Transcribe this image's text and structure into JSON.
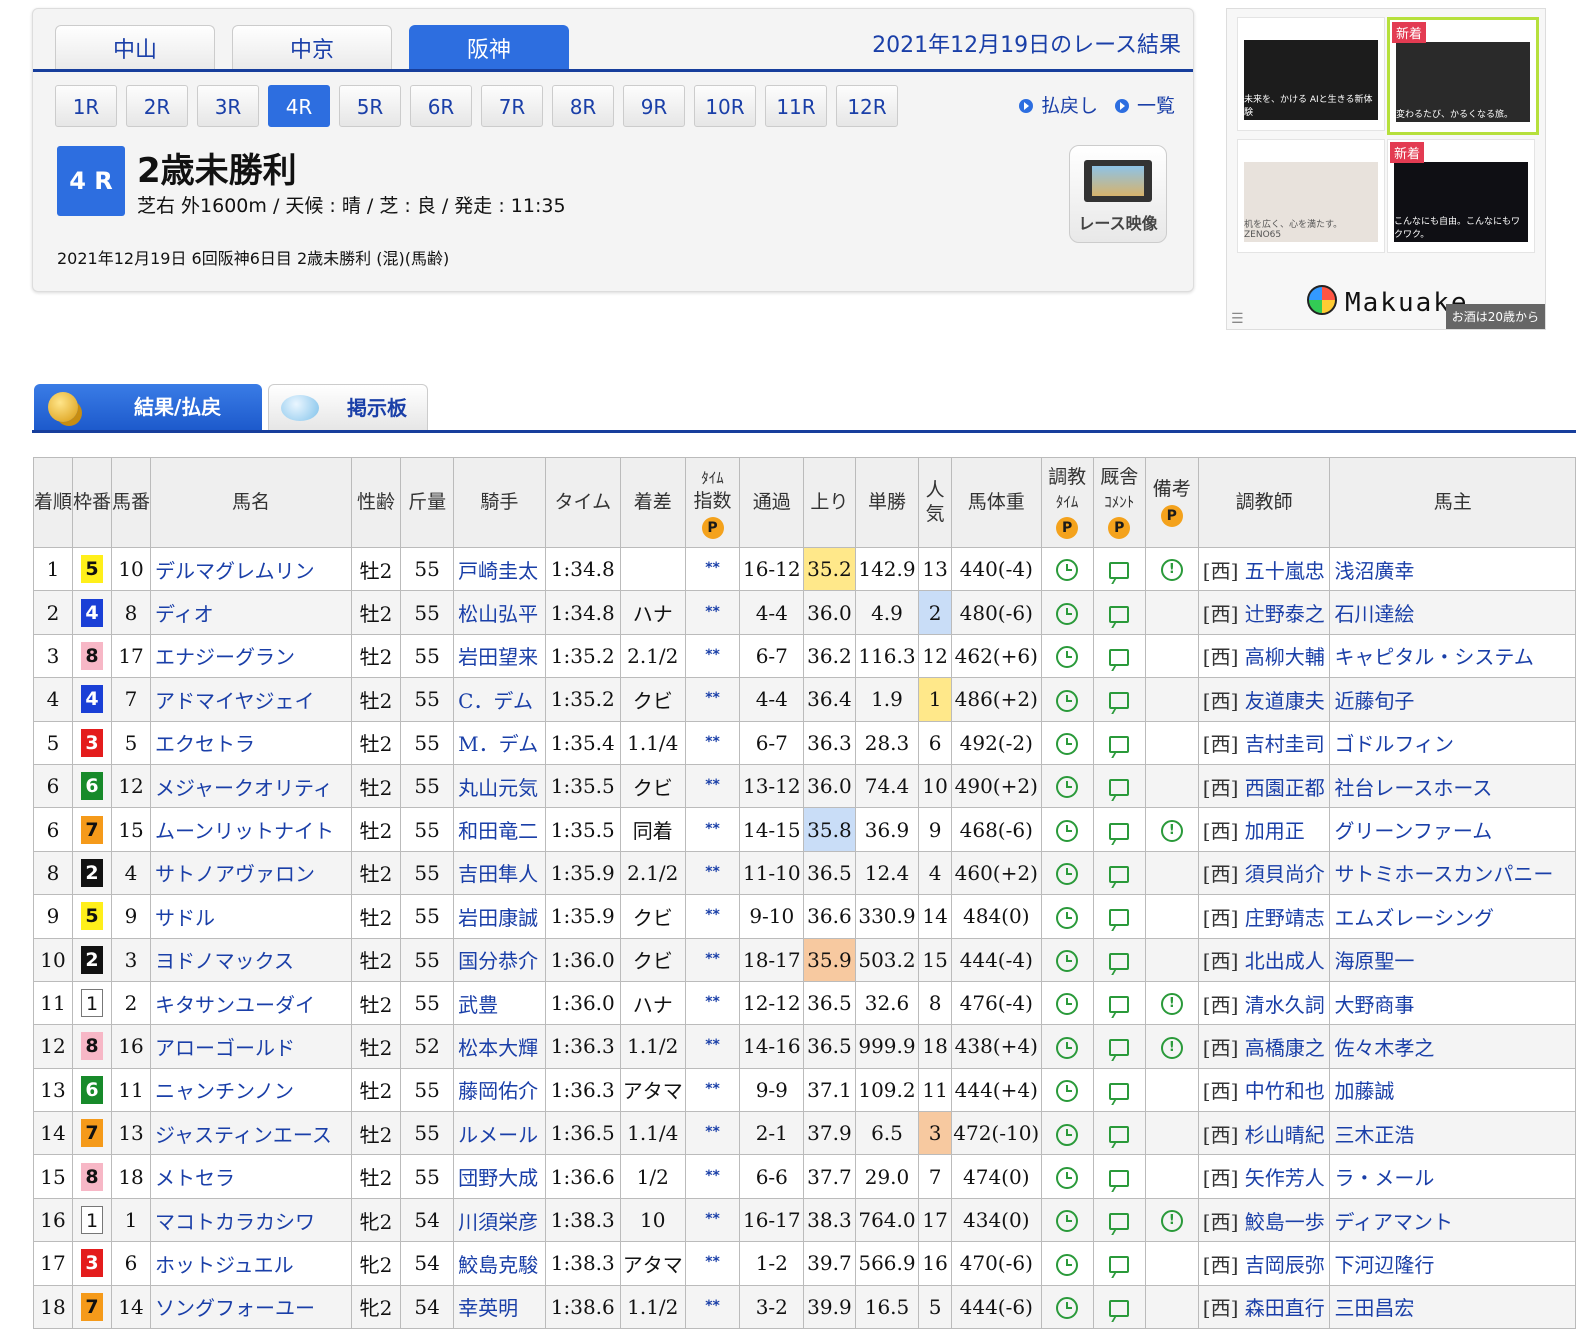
{
  "venues": [
    {
      "label": "中山",
      "active": false
    },
    {
      "label": "中京",
      "active": false
    },
    {
      "label": "阪神",
      "active": true
    }
  ],
  "result_date": "2021年12月19日のレース結果",
  "race_numbers": [
    "1R",
    "2R",
    "3R",
    "4R",
    "5R",
    "6R",
    "7R",
    "8R",
    "9R",
    "10R",
    "11R",
    "12R"
  ],
  "active_race": "4R",
  "nav_links": {
    "payout": "払戻し",
    "list": "一覧"
  },
  "race": {
    "badge": "4 R",
    "name": "2歳未勝利",
    "info": "芝右 外1600m /  天候 : 晴 /  芝 : 良  /  発走 : 11:35",
    "detail": "2021年12月19日 6回阪神6日目 2歳未勝利  (混)(馬齢)",
    "video_label": "レース映像"
  },
  "ad": {
    "new_badge": "新着",
    "tiles": [
      {
        "caption": "未来を、かける AIと生きる新体験",
        "bg": "#1c1c1c",
        "selected": false,
        "new": false
      },
      {
        "caption": "変わるたび、かるくなる旅。",
        "bg": "#2a2a2a",
        "selected": true,
        "new": true
      },
      {
        "caption": "机を広く、心を満たす。ZENO65",
        "bg": "#e8e2dc",
        "selected": false,
        "new": false
      },
      {
        "caption": "こんなにも自由。こんなにもワクワク。",
        "bg": "#0f0f14",
        "selected": false,
        "new": true
      }
    ],
    "brand": "Makuake",
    "note": "お酒は20歳から"
  },
  "content_tabs": {
    "results": "結果/払戻",
    "board": "掲示板"
  },
  "table": {
    "headers": {
      "rank": "着順",
      "waku": "枠番",
      "umaban": "馬番",
      "horse": "馬名",
      "sexage": "性齢",
      "weight": "斤量",
      "jockey": "騎手",
      "time": "タイム",
      "margin": "着差",
      "time_index_top": "ﾀｲﾑ",
      "time_index": "指数",
      "passing": "通過",
      "last3f": "上り",
      "odds": "単勝",
      "pop_top": "人",
      "pop": "気",
      "bodyweight": "馬体重",
      "train_top": "調教",
      "train": "ﾀｲﾑ",
      "stable_top": "厩舎",
      "stable": "ｺﾒﾝﾄ",
      "note": "備考",
      "trainer": "調教師",
      "owner": "馬主",
      "p": "P"
    },
    "stars": "**",
    "west": "[西]",
    "rows": [
      {
        "rank": "1",
        "waku": "5",
        "umaban": "10",
        "horse": "デルマグレムリン",
        "sexage": "牡2",
        "weight": "55",
        "jockey": "戸崎圭太",
        "time": "1:34.8",
        "margin": "",
        "passing": "16-12",
        "last3f": "35.2",
        "last3f_hl": "yellow",
        "odds": "142.9",
        "pop": "13",
        "pop_hl": "",
        "bodyweight": "440(-4)",
        "note": true,
        "trainer": "五十嵐忠",
        "owner": "浅沼廣幸"
      },
      {
        "rank": "2",
        "waku": "4",
        "umaban": "8",
        "horse": "ディオ",
        "sexage": "牡2",
        "weight": "55",
        "jockey": "松山弘平",
        "time": "1:34.8",
        "margin": "ハナ",
        "passing": "4-4",
        "last3f": "36.0",
        "last3f_hl": "",
        "odds": "4.9",
        "pop": "2",
        "pop_hl": "blue",
        "bodyweight": "480(-6)",
        "note": false,
        "trainer": "辻野泰之",
        "owner": "石川達絵"
      },
      {
        "rank": "3",
        "waku": "8",
        "umaban": "17",
        "horse": "エナジーグラン",
        "sexage": "牡2",
        "weight": "55",
        "jockey": "岩田望来",
        "time": "1:35.2",
        "margin": "2.1/2",
        "passing": "6-7",
        "last3f": "36.2",
        "last3f_hl": "",
        "odds": "116.3",
        "pop": "12",
        "pop_hl": "",
        "bodyweight": "462(+6)",
        "note": false,
        "trainer": "高柳大輔",
        "owner": "キャピタル・システム"
      },
      {
        "rank": "4",
        "waku": "4",
        "umaban": "7",
        "horse": "アドマイヤジェイ",
        "sexage": "牡2",
        "weight": "55",
        "jockey": "C．デム",
        "time": "1:35.2",
        "margin": "クビ",
        "passing": "4-4",
        "last3f": "36.4",
        "last3f_hl": "",
        "odds": "1.9",
        "pop": "1",
        "pop_hl": "yellow",
        "bodyweight": "486(+2)",
        "note": false,
        "trainer": "友道康夫",
        "owner": "近藤旬子"
      },
      {
        "rank": "5",
        "waku": "3",
        "umaban": "5",
        "horse": "エクセトラ",
        "sexage": "牡2",
        "weight": "55",
        "jockey": "M．デム",
        "time": "1:35.4",
        "margin": "1.1/4",
        "passing": "6-7",
        "last3f": "36.3",
        "last3f_hl": "",
        "odds": "28.3",
        "pop": "6",
        "pop_hl": "",
        "bodyweight": "492(-2)",
        "note": false,
        "trainer": "吉村圭司",
        "owner": "ゴドルフィン"
      },
      {
        "rank": "6",
        "waku": "6",
        "umaban": "12",
        "horse": "メジャークオリティ",
        "sexage": "牡2",
        "weight": "55",
        "jockey": "丸山元気",
        "time": "1:35.5",
        "margin": "クビ",
        "passing": "13-12",
        "last3f": "36.0",
        "last3f_hl": "",
        "odds": "74.4",
        "pop": "10",
        "pop_hl": "",
        "bodyweight": "490(+2)",
        "note": false,
        "trainer": "西園正都",
        "owner": "社台レースホース"
      },
      {
        "rank": "6",
        "waku": "7",
        "umaban": "15",
        "horse": "ムーンリットナイト",
        "sexage": "牡2",
        "weight": "55",
        "jockey": "和田竜二",
        "time": "1:35.5",
        "margin": "同着",
        "passing": "14-15",
        "last3f": "35.8",
        "last3f_hl": "blue",
        "odds": "36.9",
        "pop": "9",
        "pop_hl": "",
        "bodyweight": "468(-6)",
        "note": true,
        "trainer": "加用正",
        "owner": "グリーンファーム"
      },
      {
        "rank": "8",
        "waku": "2",
        "umaban": "4",
        "horse": "サトノアヴァロン",
        "sexage": "牡2",
        "weight": "55",
        "jockey": "吉田隼人",
        "time": "1:35.9",
        "margin": "2.1/2",
        "passing": "11-10",
        "last3f": "36.5",
        "last3f_hl": "",
        "odds": "12.4",
        "pop": "4",
        "pop_hl": "",
        "bodyweight": "460(+2)",
        "note": false,
        "trainer": "須貝尚介",
        "owner": "サトミホースカンパニー"
      },
      {
        "rank": "9",
        "waku": "5",
        "umaban": "9",
        "horse": "サドル",
        "sexage": "牡2",
        "weight": "55",
        "jockey": "岩田康誠",
        "time": "1:35.9",
        "margin": "クビ",
        "passing": "9-10",
        "last3f": "36.6",
        "last3f_hl": "",
        "odds": "330.9",
        "pop": "14",
        "pop_hl": "",
        "bodyweight": "484(0)",
        "note": false,
        "trainer": "庄野靖志",
        "owner": "エムズレーシング"
      },
      {
        "rank": "10",
        "waku": "2",
        "umaban": "3",
        "horse": "ヨドノマックス",
        "sexage": "牡2",
        "weight": "55",
        "jockey": "国分恭介",
        "time": "1:36.0",
        "margin": "クビ",
        "passing": "18-17",
        "last3f": "35.9",
        "last3f_hl": "orange",
        "odds": "503.2",
        "pop": "15",
        "pop_hl": "",
        "bodyweight": "444(-4)",
        "note": false,
        "trainer": "北出成人",
        "owner": "海原聖一"
      },
      {
        "rank": "11",
        "waku": "1",
        "umaban": "2",
        "horse": "キタサンユーダイ",
        "sexage": "牡2",
        "weight": "55",
        "jockey": "武豊",
        "time": "1:36.0",
        "margin": "ハナ",
        "passing": "12-12",
        "last3f": "36.5",
        "last3f_hl": "",
        "odds": "32.6",
        "pop": "8",
        "pop_hl": "",
        "bodyweight": "476(-4)",
        "note": true,
        "trainer": "清水久詞",
        "owner": "大野商事"
      },
      {
        "rank": "12",
        "waku": "8",
        "umaban": "16",
        "horse": "アローゴールド",
        "sexage": "牡2",
        "weight": "52",
        "jockey": "松本大輝",
        "time": "1:36.3",
        "margin": "1.1/2",
        "passing": "14-16",
        "last3f": "36.5",
        "last3f_hl": "",
        "odds": "999.9",
        "pop": "18",
        "pop_hl": "",
        "bodyweight": "438(+4)",
        "note": true,
        "trainer": "高橋康之",
        "owner": "佐々木孝之"
      },
      {
        "rank": "13",
        "waku": "6",
        "umaban": "11",
        "horse": "ニャンチンノン",
        "sexage": "牡2",
        "weight": "55",
        "jockey": "藤岡佑介",
        "time": "1:36.3",
        "margin": "アタマ",
        "passing": "9-9",
        "last3f": "37.1",
        "last3f_hl": "",
        "odds": "109.2",
        "pop": "11",
        "pop_hl": "",
        "bodyweight": "444(+4)",
        "note": false,
        "trainer": "中竹和也",
        "owner": "加藤誠"
      },
      {
        "rank": "14",
        "waku": "7",
        "umaban": "13",
        "horse": "ジャスティンエース",
        "sexage": "牡2",
        "weight": "55",
        "jockey": "ルメール",
        "time": "1:36.5",
        "margin": "1.1/4",
        "passing": "2-1",
        "last3f": "37.9",
        "last3f_hl": "",
        "odds": "6.5",
        "pop": "3",
        "pop_hl": "orange",
        "bodyweight": "472(-10)",
        "note": false,
        "trainer": "杉山晴紀",
        "owner": "三木正浩"
      },
      {
        "rank": "15",
        "waku": "8",
        "umaban": "18",
        "horse": "メトセラ",
        "sexage": "牡2",
        "weight": "55",
        "jockey": "団野大成",
        "time": "1:36.6",
        "margin": "1/2",
        "passing": "6-6",
        "last3f": "37.7",
        "last3f_hl": "",
        "odds": "29.0",
        "pop": "7",
        "pop_hl": "",
        "bodyweight": "474(0)",
        "note": false,
        "trainer": "矢作芳人",
        "owner": "ラ・メール"
      },
      {
        "rank": "16",
        "waku": "1",
        "umaban": "1",
        "horse": "マコトカラカシワ",
        "sexage": "牝2",
        "weight": "54",
        "jockey": "川須栄彦",
        "time": "1:38.3",
        "margin": "10",
        "passing": "16-17",
        "last3f": "38.3",
        "last3f_hl": "",
        "odds": "764.0",
        "pop": "17",
        "pop_hl": "",
        "bodyweight": "434(0)",
        "note": true,
        "trainer": "鮫島一歩",
        "owner": "ディアマント"
      },
      {
        "rank": "17",
        "waku": "3",
        "umaban": "6",
        "horse": "ホットジュエル",
        "sexage": "牝2",
        "weight": "54",
        "jockey": "鮫島克駿",
        "time": "1:38.3",
        "margin": "アタマ",
        "passing": "1-2",
        "last3f": "39.7",
        "last3f_hl": "",
        "odds": "566.9",
        "pop": "16",
        "pop_hl": "",
        "bodyweight": "470(-6)",
        "note": false,
        "trainer": "吉岡辰弥",
        "owner": "下河辺隆行"
      },
      {
        "rank": "18",
        "waku": "7",
        "umaban": "14",
        "horse": "ソングフォーユー",
        "sexage": "牝2",
        "weight": "54",
        "jockey": "幸英明",
        "time": "1:38.6",
        "margin": "1.1/2",
        "passing": "3-2",
        "last3f": "39.9",
        "last3f_hl": "",
        "odds": "16.5",
        "pop": "5",
        "pop_hl": "",
        "bodyweight": "444(-6)",
        "note": false,
        "trainer": "森田直行",
        "owner": "三田昌宏"
      }
    ]
  }
}
